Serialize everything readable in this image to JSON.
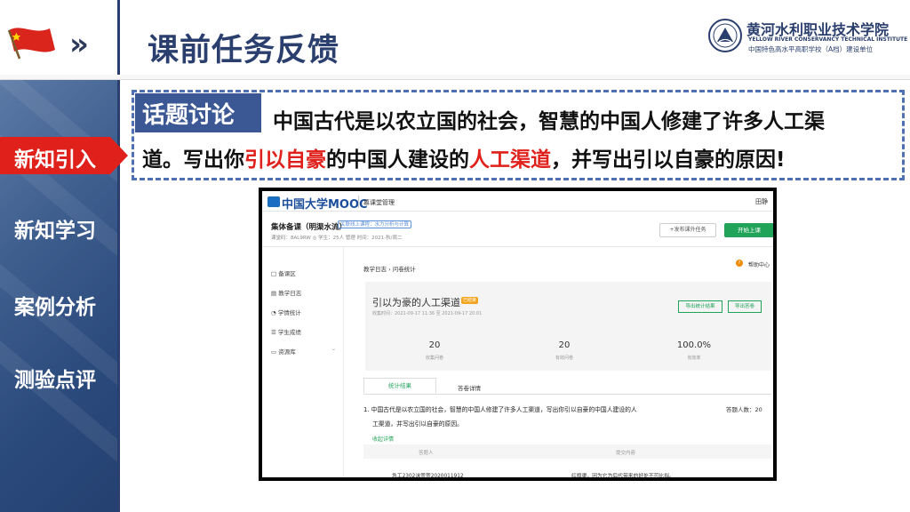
{
  "header": {
    "title": "课前任务反馈",
    "chevrons": "»",
    "school_name_cn": "黄河水利职业技术学院",
    "school_name_en": "YELLOW RIVER CONSERVANCY TECHNICAL INSTITUTE",
    "school_sub": "中国特色高水平高职学校（A档）建设单位"
  },
  "sidebar": {
    "items": [
      {
        "label": "新知引入",
        "active": true
      },
      {
        "label": "新知学习",
        "active": false
      },
      {
        "label": "案例分析",
        "active": false
      },
      {
        "label": "测验点评",
        "active": false
      }
    ]
  },
  "discussion": {
    "tag": "话题讨论",
    "line1": "中国古代是以农立国的社会，智慧的中国人修建了许多人工渠",
    "line2_a": "道。写出你",
    "line2_red1": "引以自豪",
    "line2_b": "的中国人建设的",
    "line2_red2": "人工渠道",
    "line2_c": "，并写出引以自豪的原因!"
  },
  "mooc": {
    "brand": "中国大学MOOC",
    "nav": "慕课堂管理",
    "user": "田静",
    "course_name": "集体备课（明渠水流）",
    "course_chip": "关联线上课程：水力分析与计算",
    "course_meta": "课堂码：8AL9RW  ◎     学生：25人 管理     时间：2021-秋/周二",
    "btn_publish": "+发布课外任务",
    "btn_start": "开始上课",
    "side_items": [
      "备课区",
      "教学日志",
      "学情统计",
      "学生成绩",
      "资源库"
    ],
    "side_icons": [
      "□",
      "▤",
      "◔",
      "☰",
      "▭"
    ],
    "side_caret": "⌄",
    "breadcrumb": "教学日志 › 问卷统计",
    "help_icon": "?",
    "help": "帮助中心",
    "q_title": "引以为豪的人工渠道",
    "q_badge": "已结束",
    "q_time": "收集时间：2021-09-17 11:36 至 2021-09-17 20:01",
    "btn_export": "导出统计结果",
    "btn_export2": "导出答卷",
    "stats": [
      {
        "value": "20",
        "label": "收集问卷"
      },
      {
        "value": "20",
        "label": "有效问卷"
      },
      {
        "value": "100.0%",
        "label": "有效率"
      }
    ],
    "tab_active": "统计结果",
    "tab_other": "答卷详情",
    "question_full_1": "1. 中国古代是以农立国的社会，智慧的中国人修建了许多人工渠道，写出你引以自豪的中国人建设的人",
    "question_full_2": "工渠道，并写出引以自豪的原因。",
    "answer_count": "答题人数：20",
    "collapse": "收起详情",
    "table_headers": [
      "答题人",
      "提交内容"
    ],
    "row_name": "急工2302沫萱萱2020011912",
    "row_content": "红旗渠，因为它为后代带来的好处不可比拟。"
  },
  "colors": {
    "brand_navy": "#2a3f6e",
    "accent_red": "#e0201b",
    "mooc_green": "#21a35a",
    "dashed_border": "#4f71b3"
  }
}
